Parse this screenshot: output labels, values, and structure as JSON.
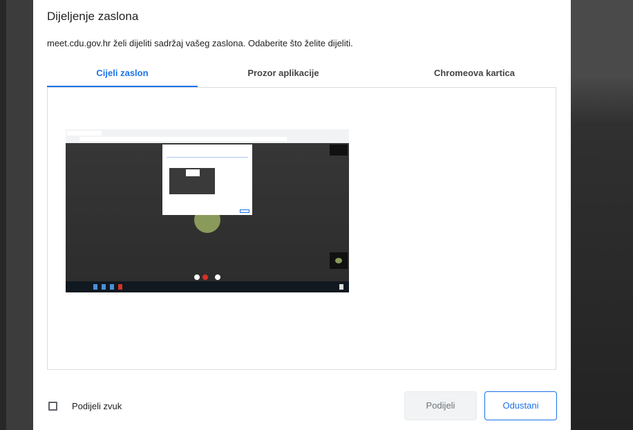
{
  "dialog": {
    "title": "Dijeljenje zaslona",
    "subtitle": "meet.cdu.gov.hr želi dijeliti sadržaj vašeg zaslona. Odaberite što želite dijeliti."
  },
  "tabs": [
    {
      "label": "Cijeli zaslon",
      "active": true
    },
    {
      "label": "Prozor aplikacije",
      "active": false
    },
    {
      "label": "Chromeova kartica",
      "active": false
    }
  ],
  "share_audio": {
    "label": "Podijeli zvuk",
    "checked": false
  },
  "buttons": {
    "share": "Podijeli",
    "cancel": "Odustani"
  },
  "colors": {
    "accent": "#1a73e8",
    "disabled_bg": "#f1f3f4",
    "text": "#202124"
  }
}
